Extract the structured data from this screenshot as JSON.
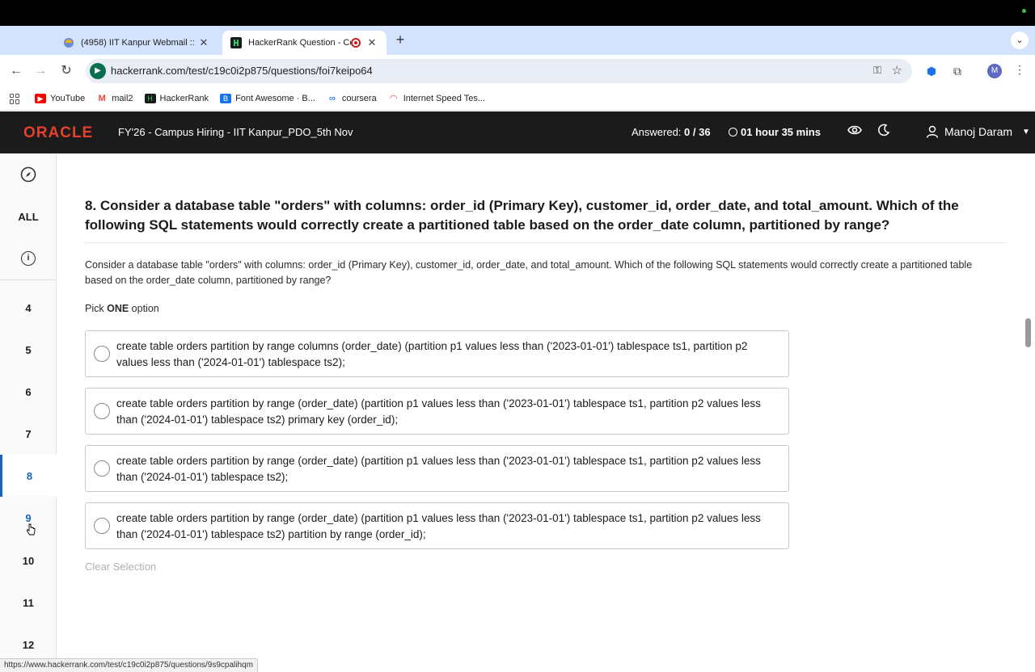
{
  "browser": {
    "tabs": [
      {
        "title": "(4958) IIT Kanpur Webmail ::",
        "active": false
      },
      {
        "title": "HackerRank Question - Co",
        "active": true,
        "recording": true
      }
    ],
    "new_tab": "+",
    "url": "hackerrank.com/test/c19c0i2p875/questions/foi7keipo64",
    "profile_initial": "M",
    "bookmarks": [
      "YouTube",
      "mail2",
      "HackerRank",
      "Font Awesome · B...",
      "coursera",
      "Internet Speed Tes..."
    ],
    "status_url": "https://www.hackerrank.com/test/c19c0i2p875/questions/9s9cpalihqm"
  },
  "header": {
    "logo": "ORACLE",
    "test_name": "FY'26 - Campus Hiring - IIT Kanpur_PDO_5th Nov",
    "answered_label": "Answered:",
    "answered_value": "0 / 36",
    "timer": "01 hour 35 mins",
    "user_name": "Manoj Daram"
  },
  "sidebar": {
    "all_label": "ALL",
    "questions": [
      "4",
      "5",
      "6",
      "7",
      "8",
      "9",
      "10",
      "11",
      "12"
    ],
    "active_question": "8"
  },
  "question": {
    "title": "8. Consider a database table \"orders\" with columns: order_id (Primary Key), customer_id, order_date, and total_amount. Which of the following SQL statements would correctly create a partitioned table based on the order_date column, partitioned by range?",
    "body": "Consider a database table \"orders\" with columns: order_id (Primary Key), customer_id, order_date, and total_amount. Which of the following SQL statements would correctly create a partitioned table based on the order_date column, partitioned by range?",
    "pick_prefix": "Pick ",
    "pick_bold": "ONE",
    "pick_suffix": " option",
    "options": [
      "create table orders partition by range columns (order_date) (partition p1 values less than ('2023-01-01') tablespace ts1, partition p2 values less than ('2024-01-01') tablespace ts2);",
      "create table orders partition by range (order_date) (partition p1 values less than ('2023-01-01') tablespace ts1, partition p2 values less than ('2024-01-01') tablespace ts2) primary key (order_id);",
      "create table orders partition by range (order_date) (partition p1 values less than ('2023-01-01') tablespace ts1, partition p2 values less than ('2024-01-01') tablespace ts2);",
      "create table orders partition by range (order_date) (partition p1 values less than ('2023-01-01') tablespace ts1, partition p2 values less than ('2024-01-01') tablespace ts2) partition by range (order_id);"
    ],
    "clear_selection": "Clear Selection"
  },
  "colors": {
    "oracle_red": "#e4402c",
    "active_blue": "#1565c0",
    "header_bg": "#1b1b1b"
  }
}
